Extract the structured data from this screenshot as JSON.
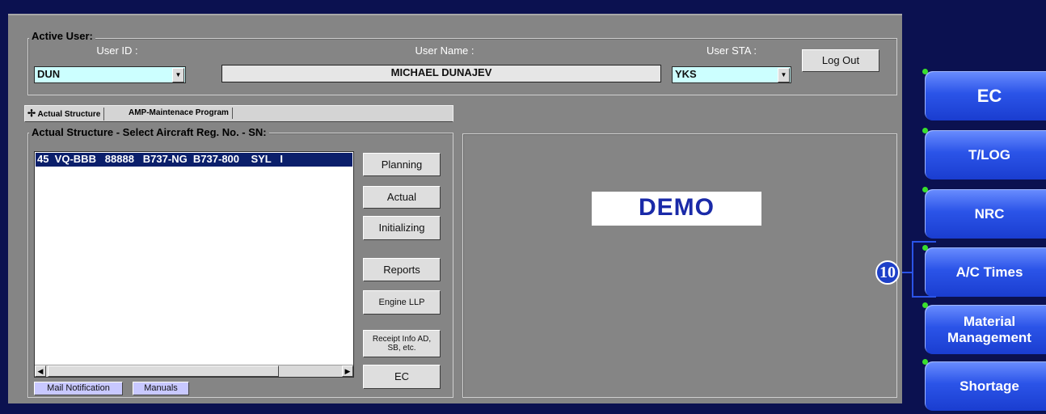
{
  "active_user": {
    "legend": "Active User:",
    "user_id_label": "User ID :",
    "user_id_value": "DUN",
    "user_name_label": "User Name :",
    "user_name_value": "MICHAEL DUNAJEV",
    "user_sta_label": "User STA :",
    "user_sta_value": "YKS",
    "logout_label": "Log Out"
  },
  "tabs": [
    {
      "label": "Actual Structure"
    },
    {
      "label": "AMP-Maintenace Program"
    }
  ],
  "structure": {
    "legend": "Actual Structure - Select Aircraft Reg. No. - SN:",
    "rows": [
      "45  VQ-BBB   88888   B737-NG  B737-800    SYL   I"
    ]
  },
  "actions": {
    "planning": "Planning",
    "actual": "Actual",
    "initializing": "Initializing",
    "reports": "Reports",
    "engine_llp": "Engine LLP",
    "receipt_info_line1": "Receipt Info AD,",
    "receipt_info_line2": "SB, etc.",
    "ec": "EC"
  },
  "bottom_buttons": {
    "mail_notification": "Mail Notification",
    "manuals": "Manuals"
  },
  "demo_label": "DEMO",
  "nav": [
    {
      "label": "EC"
    },
    {
      "label": "T/LOG"
    },
    {
      "label": "NRC"
    },
    {
      "label": "A/C Times"
    },
    {
      "label_line1": "Material",
      "label_line2": "Management"
    },
    {
      "label": "Shortage"
    }
  ],
  "callout_number": "10",
  "colors": {
    "frame": "#0b1150",
    "panel": "#858585",
    "combo_bg": "#ccffff",
    "selection": "#0b1f6b",
    "demo_text": "#1a2aa8",
    "nav_button": "#2b54e8",
    "status_dot": "#39e02c"
  }
}
